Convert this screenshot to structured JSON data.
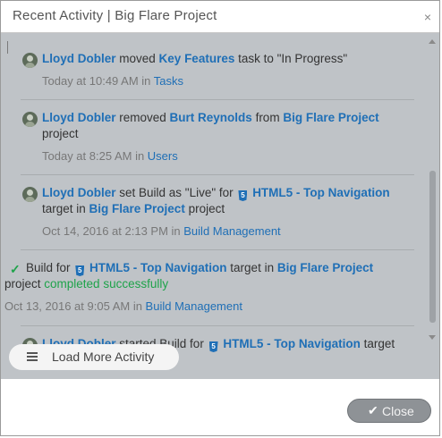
{
  "dialog": {
    "title": "Recent Activity | Big Flare Project",
    "close_x": "×"
  },
  "activities": [
    {
      "user": "Lloyd Dobler",
      "text1": " moved ",
      "link1": "Key Features",
      "text2": " task to \"In Progress\"",
      "time": "Today at 10:49 AM in ",
      "section": "Tasks"
    },
    {
      "user": "Lloyd Dobler",
      "text1": " removed ",
      "link1": "Burt Reynolds",
      "text2": "  from ",
      "link2": "Big Flare Project",
      "line2": "project",
      "time": "Today at 8:25 AM in ",
      "section": "Users"
    },
    {
      "user": "Lloyd Dobler",
      "text1": " set Build as \"Live\" for ",
      "link1": "HTML5 - Top Navigation",
      "line2_text": "target in ",
      "link2": "Big Flare Project",
      "line2_end": "  project",
      "time": "Oct 14, 2016 at 2:13 PM in ",
      "section": "Build Management"
    },
    {
      "text1": "Build for ",
      "link1": "HTML5 - Top Navigation",
      "text2": " target in ",
      "link2": "Big Flare Project",
      "line2_text": "project ",
      "status": "completed successfully",
      "time": "Oct 13, 2016 at 9:05 AM in ",
      "section": "Build Management"
    },
    {
      "user": "Lloyd Dobler",
      "text1": " started Build for ",
      "link1": "HTML5 - Top Navigation",
      "text2": " target"
    }
  ],
  "footer": {
    "load_more_label": "Load More Activity",
    "close_label": "Close"
  },
  "colors": {
    "link": "#1f6fb6",
    "success": "#1ea34a",
    "panel_bg": "#bfc3c7"
  },
  "icons": {
    "avatar": "user-avatar",
    "html5": "html5-icon",
    "check": "check-icon",
    "list": "list-icon",
    "close": "close-icon"
  }
}
